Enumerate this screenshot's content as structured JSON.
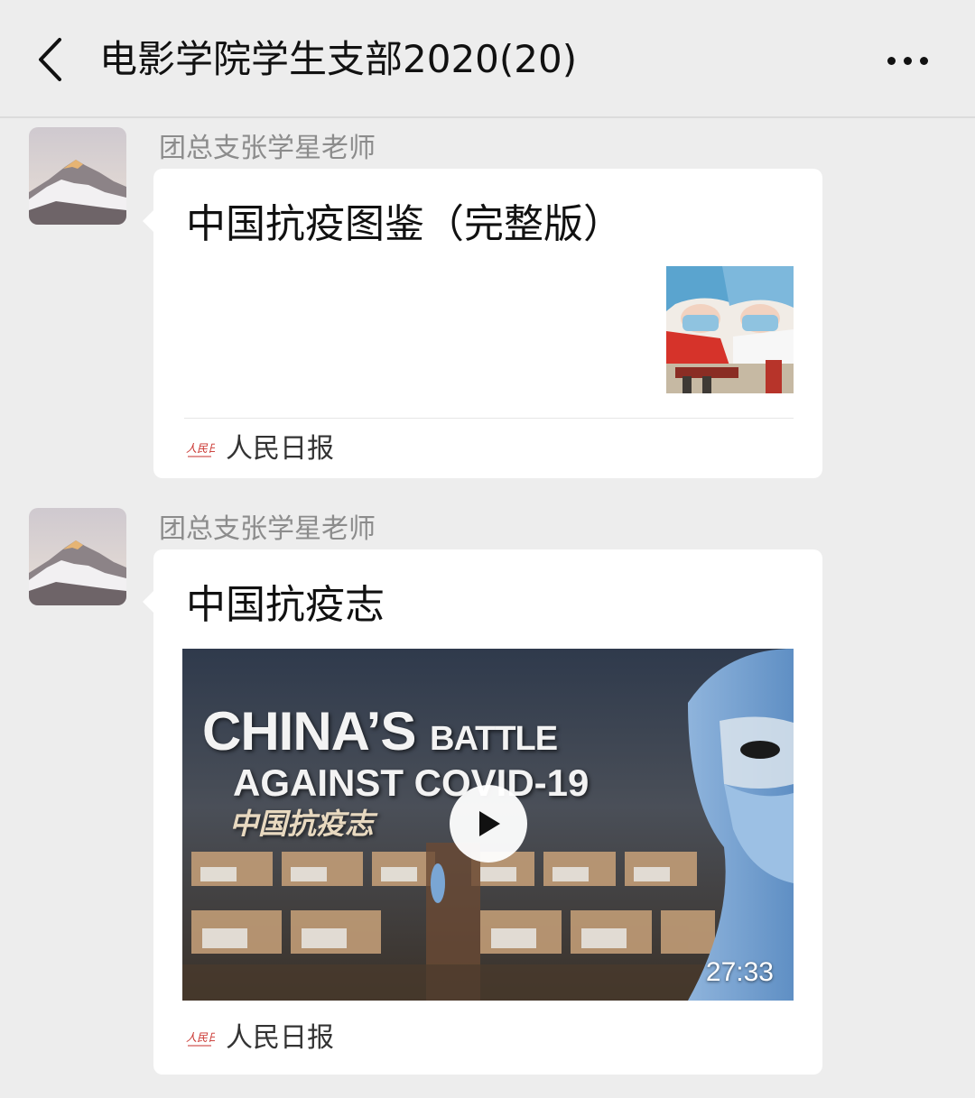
{
  "header": {
    "back_icon": "chevron-left-icon",
    "title": "电影学院学生支部2020(20)",
    "more_icon": "more-dots-icon"
  },
  "messages": [
    {
      "sender": "团总支张学星老师",
      "card": {
        "title": "中国抗疫图鉴（完整版）",
        "source": "人民日报"
      }
    },
    {
      "sender": "团总支张学星老师",
      "card": {
        "title": "中国抗疫志",
        "video_headline_1": "CHINA’S",
        "video_headline_1b": "BATTLE",
        "video_headline_2": "AGAINST COVID-19",
        "video_headline_cn": "中国抗疫志",
        "duration": "27:33",
        "source": "人民日报"
      }
    }
  ],
  "colors": {
    "background": "#ededed",
    "card": "#ffffff",
    "sender_text": "#8c8c8c"
  }
}
